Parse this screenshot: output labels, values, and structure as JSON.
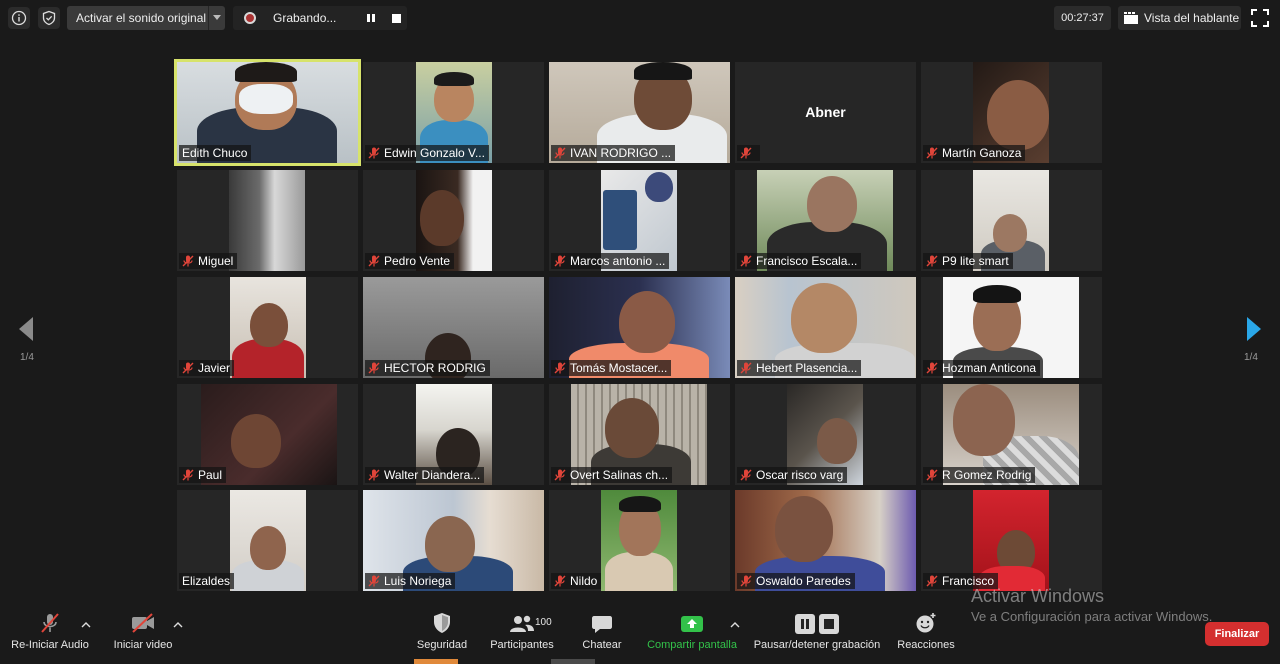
{
  "topbar": {
    "sound_button": "Activar el sonido original",
    "recording_label": "Grabando...",
    "timer": "00:27:37",
    "speaker_view": "Vista del hablante"
  },
  "pager": {
    "prev": "1/4",
    "next": "1/4"
  },
  "participants": [
    {
      "name": "Edith Chuco"
    },
    {
      "name": "Edwin Gonzalo V..."
    },
    {
      "name": "IVAN RODRIGO ..."
    },
    {
      "name": "Abner"
    },
    {
      "name": "Martín Ganoza"
    },
    {
      "name": "Miguel"
    },
    {
      "name": "Pedro Vente"
    },
    {
      "name": "Marcos antonio ..."
    },
    {
      "name": "Francisco Escala..."
    },
    {
      "name": "P9 lite smart"
    },
    {
      "name": "Javier"
    },
    {
      "name": "HECTOR RODRIG"
    },
    {
      "name": "Tomás Mostacer..."
    },
    {
      "name": "Hebert Plasencia..."
    },
    {
      "name": "Hozman Anticona"
    },
    {
      "name": "Paul"
    },
    {
      "name": "Walter Diandera..."
    },
    {
      "name": "Overt Salinas ch..."
    },
    {
      "name": "Oscar risco varg"
    },
    {
      "name": "R Gomez Rodrig"
    },
    {
      "name": "Elizaldes"
    },
    {
      "name": "Luis Noriega"
    },
    {
      "name": "Nildo"
    },
    {
      "name": "Oswaldo Paredes"
    },
    {
      "name": "Francisco"
    }
  ],
  "toolbar": {
    "audio": "Re-Iniciar Audio",
    "video": "Iniciar video",
    "security": "Seguridad",
    "participants": "Participantes",
    "participants_count": "100",
    "chat": "Chatear",
    "share": "Compartir pantalla",
    "record": "Pausar/detener grabación",
    "reactions": "Reacciones",
    "end": "Finalizar"
  },
  "watermark": {
    "line1": "Activar Windows",
    "line2": "Ve a Configuración para activar Windows."
  },
  "colors": {
    "active_speaker_border": "#d7e36b",
    "share_green": "#33c24a",
    "end_red": "#d42f2f",
    "muted_red": "#e0453a",
    "nav_blue": "#2aa7e8"
  }
}
